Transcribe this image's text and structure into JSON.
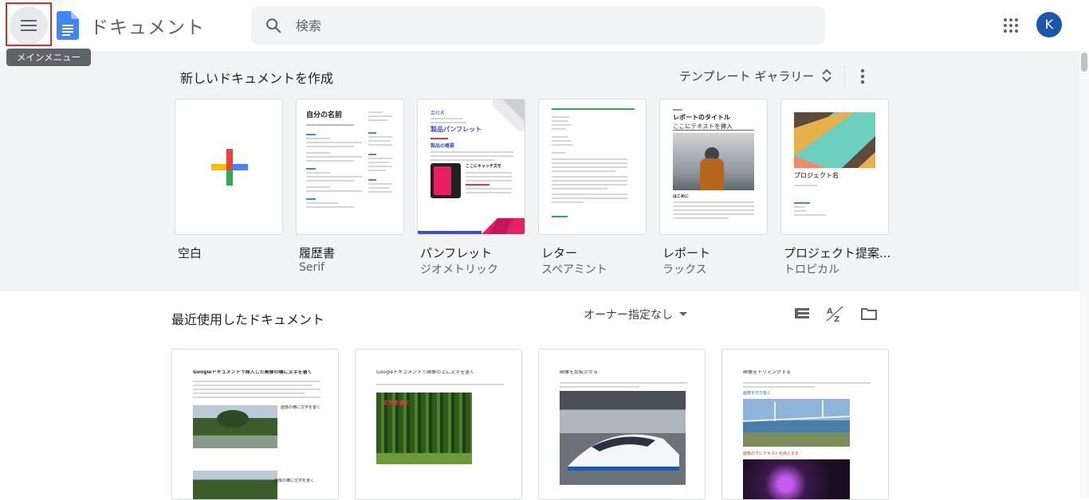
{
  "header": {
    "menu_tooltip": "メインメニュー",
    "app_title": "ドキュメント",
    "search_placeholder": "検索",
    "avatar_initial": "K"
  },
  "templates": {
    "heading": "新しいドキュメントを作成",
    "gallery_label": "テンプレート ギャラリー",
    "items": [
      {
        "name": "空白",
        "sub": ""
      },
      {
        "name": "履歴書",
        "sub": "Serif"
      },
      {
        "name": "パンフレット",
        "sub": "ジオメトリック"
      },
      {
        "name": "レター",
        "sub": "スペアミント"
      },
      {
        "name": "レポート",
        "sub": "ラックス"
      },
      {
        "name": "プロジェクト提案...",
        "sub": "トロピカル"
      }
    ],
    "thumb_text": {
      "resume_title": "自分の名前",
      "brochure_title": "製品パンフレット",
      "brochure_company": "会社名",
      "brochure_overview": "製品の概要",
      "brochure_here": "ここにキャッチ文を",
      "report_title": "レポートのタイトル",
      "report_subtitle": "ここにテキストを挿入",
      "report_intro": "はじめに",
      "project_title": "プロジェクト名"
    }
  },
  "recent": {
    "heading": "最近使用したドキュメント",
    "owner_filter": "オーナー指定なし",
    "docs": [
      {
        "title": "Googleドキュメントで挿入した画像の横に文字を書く",
        "caption": "画像の横に文字を書く",
        "caption2": "画像の横に文字を書く"
      },
      {
        "title": "Googleドキュメントで画像の上に文字を書く",
        "overlay": "文字を書く"
      },
      {
        "title": "画像を反転させる"
      },
      {
        "title": "画像をトリミングする",
        "link": "画像を切り抜く",
        "red_note": "画像の下にテキストを挿入する"
      }
    ]
  },
  "colors": {
    "docs_blue": "#4285f4",
    "highlight_red": "#d93025",
    "avatar": "#1a57a8",
    "template_bg": "#f1f3f4"
  }
}
